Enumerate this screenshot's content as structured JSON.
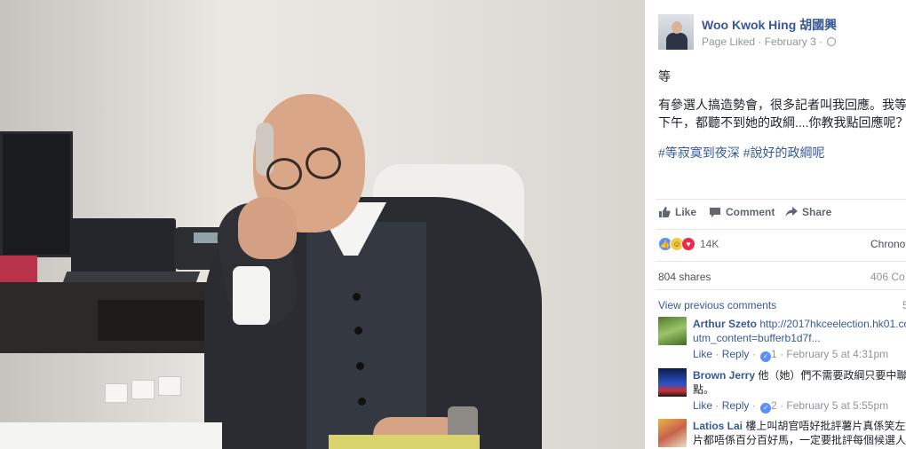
{
  "post": {
    "author": "Woo Kwok Hing 胡國興",
    "meta_status": "Page Liked",
    "meta_separator": " · ",
    "date": "February 3",
    "text_line1": "等",
    "text_line2": "有參選人搞造勢會，很多記者叫我回應。我等足",
    "text_line3": "下午，都聽不到她的政綱....你教我點回應呢？",
    "hashtag1": "#等寂寞到夜深",
    "hashtag2": "#說好的政綱呢"
  },
  "actions": {
    "like": "Like",
    "comment": "Comment",
    "share": "Share"
  },
  "stats": {
    "reactions_count": "14K",
    "sort_label": "Chronol",
    "shares": "804 shares",
    "comments_partial": "406 Co"
  },
  "comments_section": {
    "view_previous": "View previous comments",
    "page_partial": "5"
  },
  "comments": [
    {
      "name": "Arthur Szeto",
      "text_line1": "http://2017hkceelection.hk01.cor",
      "text_line2": "utm_content=bufferb1d7f...",
      "like": "Like",
      "reply": "Reply",
      "likes": "1",
      "time": "February 5 at 4:31pm"
    },
    {
      "name": "Brown Jerry",
      "text_line1": "他（她）們不需要政綱只要中聯",
      "text_line2": "點。",
      "like": "Like",
      "reply": "Reply",
      "likes": "2",
      "time": "February 5 at 5:55pm"
    },
    {
      "name": "Latios Lai",
      "text_line1": "樓上叫胡官唔好批評薯片真係笑左",
      "text_line2": "片都唔係百分百好馬，一定要批評每個候選人，"
    }
  ],
  "colors": {
    "link": "#365899",
    "meta": "#90949c",
    "like_blue": "#5890ff",
    "love_red": "#f0284a"
  },
  "icons": [
    "thumbs-up-icon",
    "comment-icon",
    "share-icon",
    "globe-icon",
    "like-reaction-icon",
    "haha-reaction-icon",
    "love-reaction-icon"
  ]
}
